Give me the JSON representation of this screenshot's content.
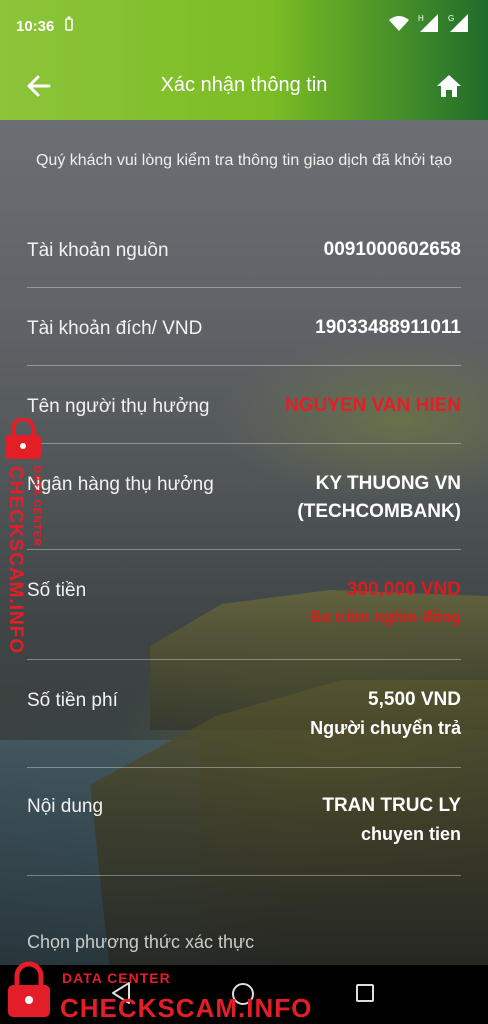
{
  "status": {
    "time": "10:36"
  },
  "header": {
    "title": "Xác nhận thông tin"
  },
  "intro": "Quý khách vui lòng kiểm tra thông tin giao dịch đã khởi tạo",
  "rows": [
    {
      "label": "Tài khoản nguồn",
      "value": "0091000602658",
      "sub": ""
    },
    {
      "label": "Tài khoản đích/ VND",
      "value": "19033488911011",
      "sub": ""
    },
    {
      "label": "Tên người thụ hưởng",
      "value": "NGUYEN VAN HIEN",
      "sub": ""
    },
    {
      "label": "Ngân hàng thụ hưởng",
      "value": "KY THUONG VN",
      "sub": "(TECHCOMBANK)"
    },
    {
      "label": "Số tiền",
      "value": "300,000 VND",
      "sub": "Ba trăm nghìn đồng"
    },
    {
      "label": "Số tiền phí",
      "value": "5,500 VND",
      "sub": "Người chuyển trả"
    },
    {
      "label": "Nội dung",
      "value": "TRAN TRUC LY",
      "sub": "chuyen tien"
    }
  ],
  "section_caption": "Chọn phương thức xác thực",
  "watermark": {
    "brand": "CHECKSCAM.INFO",
    "data_center": "DATA CENTER"
  },
  "colors": {
    "header_start": "#8cc43a",
    "header_end": "#1f6b2a",
    "alert_red": "#e41e26"
  }
}
